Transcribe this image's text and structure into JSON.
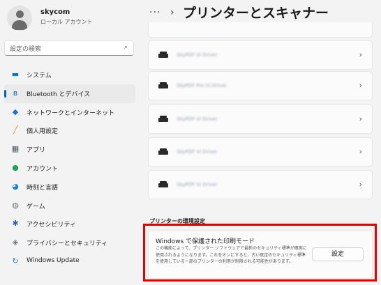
{
  "user": {
    "name": "skycom",
    "account": "ローカル アカウント"
  },
  "search": {
    "placeholder": "設定の検索"
  },
  "nav": [
    {
      "label": "システム",
      "icon": "monitor-icon",
      "color": "#0078d4",
      "glyph": "▬"
    },
    {
      "label": "Bluetooth とデバイス",
      "icon": "bluetooth-icon",
      "color": "#0067c0",
      "glyph": "ʙ",
      "active": true
    },
    {
      "label": "ネットワークとインターネット",
      "icon": "wifi-icon",
      "color": "#1c6dd0",
      "glyph": "◆"
    },
    {
      "label": "個人用設定",
      "icon": "paintbrush-icon",
      "color": "#e08a2c",
      "glyph": "╱"
    },
    {
      "label": "アプリ",
      "icon": "apps-icon",
      "color": "#4a5a6a",
      "glyph": "▦"
    },
    {
      "label": "アカウント",
      "icon": "person-icon",
      "color": "#22a35a",
      "glyph": "●"
    },
    {
      "label": "時刻と言語",
      "icon": "globe-clock-icon",
      "color": "#1f80d6",
      "glyph": "◕"
    },
    {
      "label": "ゲーム",
      "icon": "game-controller-icon",
      "color": "#6a7380",
      "glyph": "◍"
    },
    {
      "label": "アクセシビリティ",
      "icon": "accessibility-icon",
      "color": "#1a62c0",
      "glyph": "✱"
    },
    {
      "label": "プライバシーとセキュリティ",
      "icon": "shield-icon",
      "color": "#6a7380",
      "glyph": "◈"
    },
    {
      "label": "Windows Update",
      "icon": "update-icon",
      "color": "#1f80d6",
      "glyph": "↻"
    }
  ],
  "header": {
    "dots": "···",
    "separator": "›",
    "title": "プリンターとスキャナー"
  },
  "printers": [
    {
      "name": "SkyPDF Vi Driver"
    },
    {
      "name": "SkyPDF Pro Vi Driver"
    },
    {
      "name": "SkyPDF Vi Driver"
    },
    {
      "name": "SkyPDF Vi Driver"
    },
    {
      "name": "SkyPDF Vi Driver"
    }
  ],
  "arrow": "›",
  "section_title": "プリンターの環境設定",
  "protected": {
    "title": "Windows で保護された印刷モード",
    "description": "この機能によって、プリンター ソフトウェアで最新のセキュリティ標準が確実に使用されるようになります。これをオンにすると、古い既定のセキュリティ標準を使用している一部のプリンターの利用が制限される可能性があります。",
    "button": "設定"
  },
  "colors": {
    "accent": "#0067c0",
    "highlight": "#e60000",
    "background": "#f3f3f3"
  }
}
